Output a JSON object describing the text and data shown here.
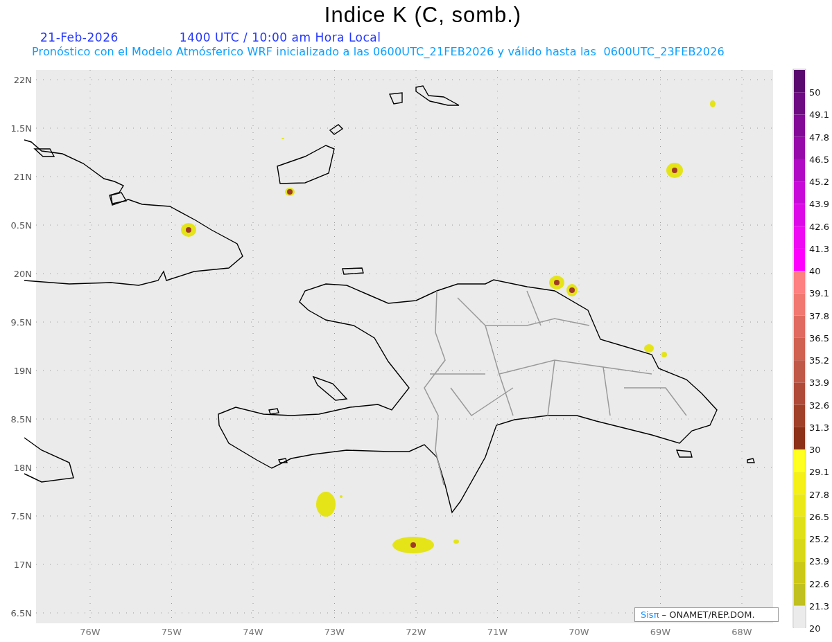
{
  "title": "Indice K (C, somb.)",
  "date": "21-Feb-2026",
  "time": "1400 UTC / 10:00 am Hora Local",
  "subtitle": "Pronóstico con el Modelo Atmósferico WRF inicializado a las 0600UTC_21FEB2026 y válido hasta las  0600UTC_23FEB2026",
  "map": {
    "y_labels": [
      "22N",
      "1.5N",
      "21N",
      "0.5N",
      "20N",
      "9.5N",
      "19N",
      "8.5N",
      "18N",
      "7.5N",
      "17N",
      "6.5N"
    ],
    "x_labels": [
      "76W",
      "75W",
      "74W",
      "73W",
      "72W",
      "71W",
      "70W",
      "69W",
      "68W"
    ],
    "credit": {
      "brand": "Sisπ",
      "text": "– ONAMET/REP.DOM."
    }
  },
  "colorbar": {
    "bins": [
      {
        "color": "#5a0a6e"
      },
      {
        "color": "#6e0a82"
      },
      {
        "color": "#820a96"
      },
      {
        "color": "#960aaa"
      },
      {
        "color": "#b00ac4"
      },
      {
        "color": "#c80ad8"
      },
      {
        "color": "#dc0ae6"
      },
      {
        "color": "#ee0af2"
      },
      {
        "color": "#ff00ff"
      },
      {
        "color": "#ff8080"
      },
      {
        "color": "#f07870"
      },
      {
        "color": "#e06a60"
      },
      {
        "color": "#d06050"
      },
      {
        "color": "#c05848"
      },
      {
        "color": "#b04a38"
      },
      {
        "color": "#a04028"
      },
      {
        "color": "#8c3018"
      },
      {
        "color": "#ffff20"
      },
      {
        "color": "#f4f018"
      },
      {
        "color": "#eae818"
      },
      {
        "color": "#e0e018"
      },
      {
        "color": "#d8d818"
      },
      {
        "color": "#ccc818"
      },
      {
        "color": "#c0c020"
      },
      {
        "color": "#ebebeb"
      }
    ],
    "labels": [
      "50",
      "49.1",
      "47.8",
      "46.5",
      "45.2",
      "43.9",
      "42.6",
      "41.3",
      "40",
      "39.1",
      "37.8",
      "36.5",
      "35.2",
      "33.9",
      "32.6",
      "31.3",
      "30",
      "29.1",
      "27.8",
      "26.5",
      "25.2",
      "23.9",
      "22.6",
      "21.3",
      "20"
    ]
  }
}
